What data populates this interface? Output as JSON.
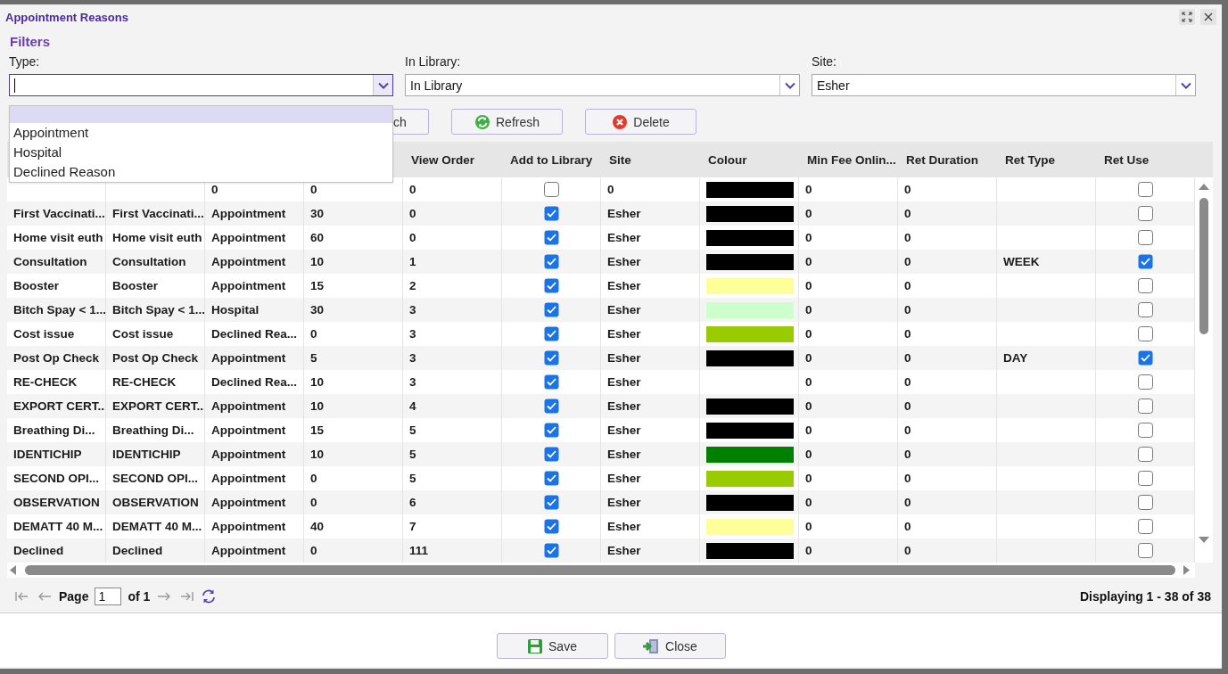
{
  "window": {
    "title": "Appointment Reasons"
  },
  "filters": {
    "heading": "Filters",
    "fields": [
      {
        "label": "Type:",
        "focused": true
      },
      {
        "label": "In Library:",
        "value": "In Library",
        "focused": false
      },
      {
        "label": "Site:",
        "value": "Esher",
        "focused": false
      }
    ]
  },
  "type_dropdown": {
    "blank_highlighted": true,
    "options": [
      {
        "label": "Appointment",
        "selected": false
      },
      {
        "label": "Hospital",
        "selected": false
      },
      {
        "label": "Declined Reason",
        "selected": false
      }
    ]
  },
  "toolbar": [
    {
      "kind": "search",
      "label": "ch"
    },
    {
      "kind": "refresh",
      "label": "Refresh"
    },
    {
      "kind": "delete",
      "label": "Delete"
    }
  ],
  "table": {
    "columns": [
      "View Order",
      "Add to Library",
      "Site",
      "Colour",
      "Min Fee Onlin...",
      "Ret Duration",
      "Ret Type",
      "Ret Use"
    ],
    "rows": [
      {
        "column_3": "0",
        "column_4": "0",
        "view_order": "0",
        "add_to_library": false,
        "site": "0",
        "color": "#000000",
        "min_fee": "0",
        "ret_duration": "0",
        "ret_use": false
      },
      {
        "column_1": "First Vaccinati...",
        "column_2": "First Vaccinati...",
        "column_3": "Appointment",
        "column_4": "30",
        "view_order": "0",
        "add_to_library": true,
        "site": "Esher",
        "color": "#000000",
        "min_fee": "0",
        "ret_duration": "0",
        "ret_use": false
      },
      {
        "column_1": "Home visit euth",
        "column_2": "Home visit euth",
        "column_3": "Appointment",
        "column_4": "60",
        "view_order": "0",
        "add_to_library": true,
        "site": "Esher",
        "color": "#000000",
        "min_fee": "0",
        "ret_duration": "0",
        "ret_use": false
      },
      {
        "column_1": "Consultation",
        "column_2": "Consultation",
        "column_3": "Appointment",
        "column_4": "10",
        "view_order": "1",
        "add_to_library": true,
        "site": "Esher",
        "color": "#000000",
        "min_fee": "0",
        "ret_duration": "0",
        "ret_type": "WEEK",
        "ret_use": true
      },
      {
        "column_1": "Booster",
        "column_2": "Booster",
        "column_3": "Appointment",
        "column_4": "15",
        "view_order": "2",
        "add_to_library": true,
        "site": "Esher",
        "color": "#ffff99",
        "min_fee": "0",
        "ret_duration": "0",
        "ret_use": false
      },
      {
        "column_1": "Bitch Spay < 1...",
        "column_2": "Bitch Spay < 1...",
        "column_3": "Hospital",
        "column_4": "30",
        "view_order": "3",
        "add_to_library": true,
        "site": "Esher",
        "color": "#ccffcc",
        "min_fee": "0",
        "ret_duration": "0",
        "ret_use": false
      },
      {
        "column_1": "Cost issue",
        "column_2": "Cost issue",
        "column_3": "Declined Rea...",
        "column_4": "0",
        "view_order": "3",
        "add_to_library": true,
        "site": "Esher",
        "color": "#99cc00",
        "min_fee": "0",
        "ret_duration": "0",
        "ret_use": false
      },
      {
        "column_1": "Post Op Check",
        "column_2": "Post Op Check",
        "column_3": "Appointment",
        "column_4": "5",
        "view_order": "3",
        "add_to_library": true,
        "site": "Esher",
        "color": "#000000",
        "min_fee": "0",
        "ret_duration": "0",
        "ret_type": "DAY",
        "ret_use": true
      },
      {
        "column_1": "RE-CHECK",
        "column_2": "RE-CHECK",
        "column_3": "Declined Rea...",
        "column_4": "10",
        "view_order": "3",
        "add_to_library": true,
        "site": "Esher",
        "min_fee": "0",
        "ret_duration": "0",
        "ret_use": false
      },
      {
        "column_1": "EXPORT CERT...",
        "column_2": "EXPORT CERT...",
        "column_3": "Appointment",
        "column_4": "10",
        "view_order": "4",
        "add_to_library": true,
        "site": "Esher",
        "color": "#000000",
        "min_fee": "0",
        "ret_duration": "0",
        "ret_use": false
      },
      {
        "column_1": "Breathing Di...",
        "column_2": "Breathing Di...",
        "column_3": "Appointment",
        "column_4": "15",
        "view_order": "5",
        "add_to_library": true,
        "site": "Esher",
        "color": "#000000",
        "min_fee": "0",
        "ret_duration": "0",
        "ret_use": false
      },
      {
        "column_1": "IDENTICHIP",
        "column_2": "IDENTICHIP",
        "column_3": "Appointment",
        "column_4": "10",
        "view_order": "5",
        "add_to_library": true,
        "site": "Esher",
        "color": "#008000",
        "min_fee": "0",
        "ret_duration": "0",
        "ret_use": false
      },
      {
        "column_1": "SECOND OPI...",
        "column_2": "SECOND OPI...",
        "column_3": "Appointment",
        "column_4": "0",
        "view_order": "5",
        "add_to_library": true,
        "site": "Esher",
        "color": "#99cc00",
        "min_fee": "0",
        "ret_duration": "0",
        "ret_use": false
      },
      {
        "column_1": "OBSERVATION",
        "column_2": "OBSERVATION",
        "column_3": "Appointment",
        "column_4": "0",
        "view_order": "6",
        "add_to_library": true,
        "site": "Esher",
        "color": "#000000",
        "min_fee": "0",
        "ret_duration": "0",
        "ret_use": false
      },
      {
        "column_1": "DEMATT 40 M...",
        "column_2": "DEMATT 40 M...",
        "column_3": "Appointment",
        "column_4": "40",
        "view_order": "7",
        "add_to_library": true,
        "site": "Esher",
        "color": "#ffff99",
        "min_fee": "0",
        "ret_duration": "0",
        "ret_use": false
      },
      {
        "column_1": "Declined",
        "column_2": "Declined",
        "column_3": "Appointment",
        "column_4": "0",
        "view_order": "111",
        "add_to_library": true,
        "site": "Esher",
        "color": "#000000",
        "min_fee": "0",
        "ret_duration": "0",
        "ret_use": false
      }
    ]
  },
  "pager": {
    "page_label": "Page",
    "page": "1",
    "of": "of 1",
    "summary": "Displaying 1 - 38 of 38"
  },
  "footer": [
    {
      "kind": "save",
      "label": "Save"
    },
    {
      "kind": "close",
      "label": "Close"
    }
  ]
}
